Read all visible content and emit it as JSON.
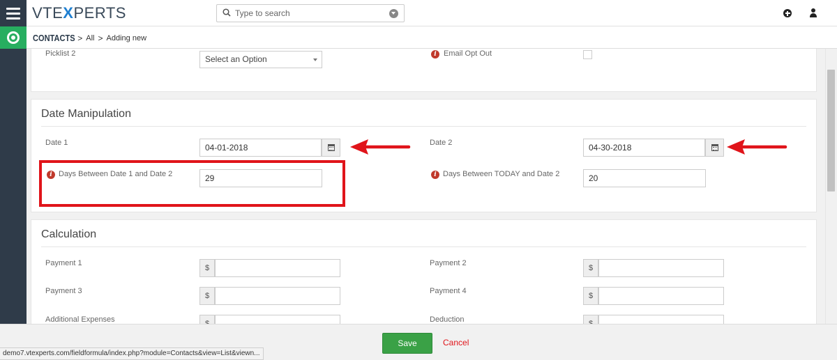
{
  "topbar": {
    "logo_prefix": "VTE",
    "logo_x": "X",
    "logo_suffix": "PERTS",
    "search_placeholder": "Type to search"
  },
  "breadcrumb": {
    "module": "CONTACTS",
    "sep": ">",
    "all": "All",
    "current": "Adding new"
  },
  "top_section": {
    "picklist_label": "Picklist 2",
    "picklist_value": "Select an Option",
    "email_opt_out_label": "Email Opt Out"
  },
  "date_section": {
    "title": "Date Manipulation",
    "date1_label": "Date 1",
    "date1_value": "04-01-2018",
    "date2_label": "Date 2",
    "date2_value": "04-30-2018",
    "days_between_label": "Days Between Date 1 and Date 2",
    "days_between_value": "29",
    "days_today_label": "Days Between TODAY and Date 2",
    "days_today_value": "20"
  },
  "calc_section": {
    "title": "Calculation",
    "currency": "$",
    "payment1_label": "Payment 1",
    "payment2_label": "Payment 2",
    "payment3_label": "Payment 3",
    "payment4_label": "Payment 4",
    "additional_label": "Additional Expenses",
    "deduction_label": "Deduction"
  },
  "footer": {
    "save_label": "Save",
    "cancel_label": "Cancel",
    "status_url": "demo7.vtexperts.com/fieldformula/index.php?module=Contacts&view=List&viewn..."
  },
  "colors": {
    "sidebar": "#2f3b49",
    "module_accent": "#27ae60",
    "save_button": "#3aa146",
    "annotation_red": "#e0141a"
  }
}
